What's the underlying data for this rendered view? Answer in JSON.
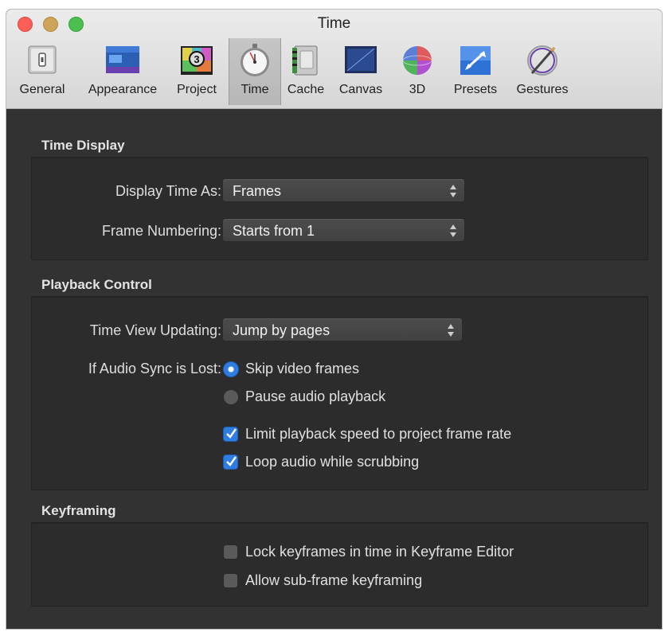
{
  "window": {
    "title": "Time"
  },
  "toolbar": {
    "tabs": [
      {
        "label": "General",
        "icon": "general-icon"
      },
      {
        "label": "Appearance",
        "icon": "appearance-icon"
      },
      {
        "label": "Project",
        "icon": "project-icon"
      },
      {
        "label": "Time",
        "icon": "stopwatch-icon",
        "selected": true
      },
      {
        "label": "Cache",
        "icon": "cache-icon"
      },
      {
        "label": "Canvas",
        "icon": "canvas-icon"
      },
      {
        "label": "3D",
        "icon": "3d-icon"
      },
      {
        "label": "Presets",
        "icon": "presets-icon"
      },
      {
        "label": "Gestures",
        "icon": "gestures-icon"
      }
    ]
  },
  "time_display": {
    "title": "Time Display",
    "display_time_as": {
      "label": "Display Time As:",
      "value": "Frames"
    },
    "frame_numbering": {
      "label": "Frame Numbering:",
      "value": "Starts from 1"
    }
  },
  "playback_control": {
    "title": "Playback Control",
    "time_view_updating": {
      "label": "Time View Updating:",
      "value": "Jump by pages"
    },
    "audio_sync": {
      "label": "If Audio Sync is Lost:",
      "options": [
        {
          "label": "Skip video frames",
          "selected": true
        },
        {
          "label": "Pause audio playback",
          "selected": false
        }
      ]
    },
    "limit_playback": {
      "label": "Limit playback speed to project frame rate",
      "checked": true
    },
    "loop_audio": {
      "label": "Loop audio while scrubbing",
      "checked": true
    }
  },
  "keyframing": {
    "title": "Keyframing",
    "lock_keyframes": {
      "label": "Lock keyframes in time in Keyframe Editor",
      "checked": false
    },
    "sub_frame": {
      "label": "Allow sub-frame keyframing",
      "checked": false
    }
  },
  "colors": {
    "accent": "#2f7de1",
    "panel_bg": "#323232",
    "toolbar_bg": "#e0e0e0"
  }
}
